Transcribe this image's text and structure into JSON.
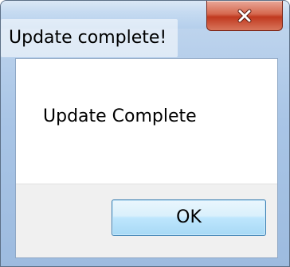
{
  "dialog": {
    "title": "Update complete!",
    "message": "Update Complete",
    "ok_label": "OK"
  },
  "icons": {
    "close": "close-icon"
  },
  "colors": {
    "close_button": "#c0391f",
    "ok_button_border": "#3c7fb1",
    "footer_background": "#f0f0f0"
  }
}
